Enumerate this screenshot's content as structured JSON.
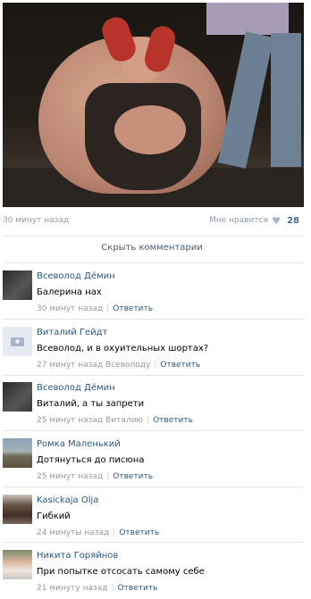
{
  "post": {
    "time": "30 минут назад",
    "like_label": "Мне нравится",
    "like_count": "28"
  },
  "hide_comments": "Скрыть комментарии",
  "comments": [
    {
      "name": "Всеволод Дёмин",
      "text": "Балерина нах",
      "time": "30 минут назад",
      "reply": "Ответить",
      "avatar": "dark"
    },
    {
      "name": "Виталий Гейдт",
      "text": "Всеволод, и в охуительных шортах?",
      "time": "27 минут назад Всеволоду",
      "reply": "Ответить",
      "avatar": "camera"
    },
    {
      "name": "Всеволод Дёмин",
      "text": "Виталий, а ты запрети",
      "time": "25 минут назад Виталию",
      "reply": "Ответить",
      "avatar": "dark"
    },
    {
      "name": "Ромка Маленький",
      "text": "Дотянуться до писюна",
      "time": "25 минут назад",
      "reply": "Ответить",
      "avatar": "tank"
    },
    {
      "name": "Kasickaja Olja",
      "text": "Гибкий",
      "time": "24 минуты назад",
      "reply": "Ответить",
      "avatar": "girl"
    },
    {
      "name": "Никита Горяйнов",
      "text": "При попытке отсосать самому себе",
      "time": "21 минуту назад",
      "reply": "Ответить",
      "avatar": "face"
    }
  ]
}
